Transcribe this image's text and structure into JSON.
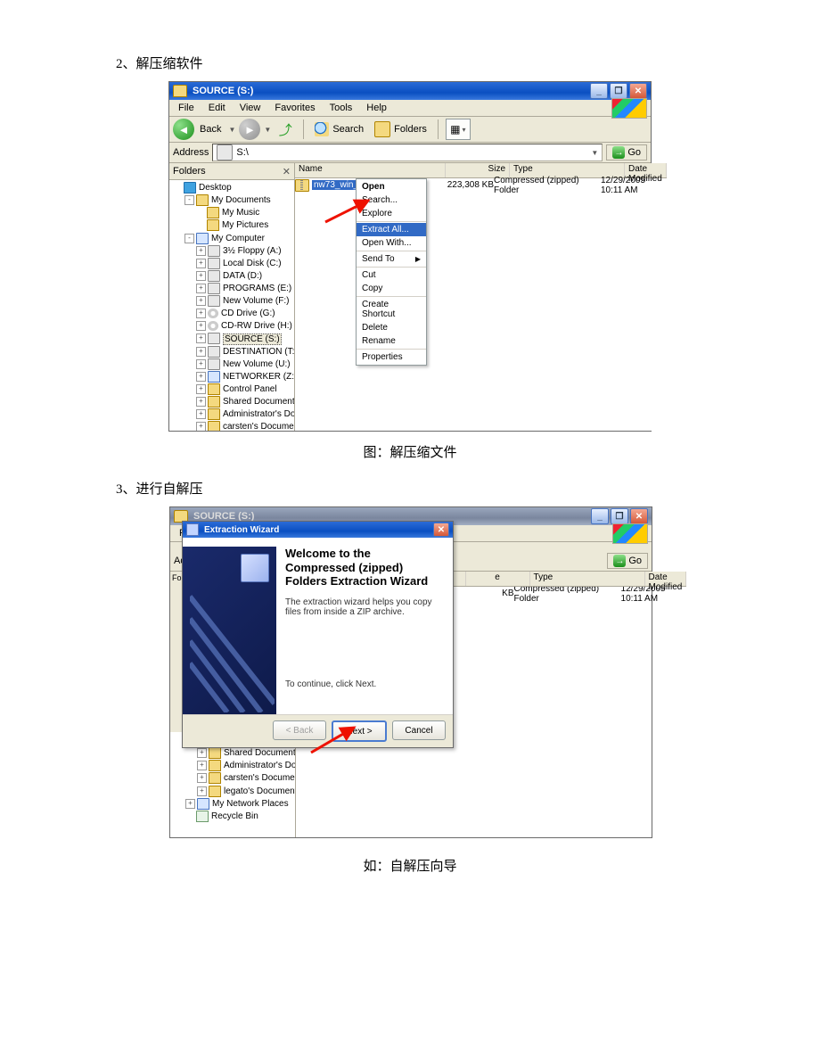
{
  "doc": {
    "step2": "2、解压缩软件",
    "caption1": "图：解压缩文件",
    "step3": "3、进行自解压",
    "caption2": "如：自解压向导"
  },
  "explorer": {
    "title": "SOURCE (S:)",
    "menu": [
      "File",
      "Edit",
      "View",
      "Favorites",
      "Tools",
      "Help"
    ],
    "back": "Back",
    "search": "Search",
    "folders": "Folders",
    "go": "Go",
    "addressLabel": "Address",
    "addressValue": "S:\\",
    "foldersHeader": "Folders",
    "columns": {
      "name": "Name",
      "size": "Size",
      "type": "Type",
      "date": "Date Modified"
    },
    "file": {
      "name": "nw73_win_x86",
      "size": "223,308 KB",
      "type": "Compressed (zipped) Folder",
      "date": "12/29/2005 10:11 AM"
    },
    "tree": {
      "desktop": "Desktop",
      "mydocs": "My Documents",
      "mymusic": "My Music",
      "mypics": "My Pictures",
      "mycomp": "My Computer",
      "drives": [
        "3½ Floppy (A:)",
        "Local Disk (C:)",
        "DATA (D:)",
        "PROGRAMS (E:)",
        "New Volume (F:)",
        "CD Drive (G:)",
        "CD-RW Drive (H:)",
        "SOURCE (S:)",
        "DESTINATION (T:)",
        "New Volume (U:)",
        "NETWORKER (Z:)",
        "Control Panel",
        "Shared Documents",
        "Administrator's Documents",
        "carsten's Documents",
        "legato's Documents"
      ],
      "netplaces": "My Network Places",
      "recycle": "Recycle Bin"
    },
    "treeBottom": [
      "Control Panel",
      "Shared Documents",
      "Administrator's Documents",
      "carsten's Documents",
      "legato's Documents"
    ]
  },
  "ctx": {
    "open": "Open",
    "search": "Search...",
    "explore": "Explore",
    "extract": "Extract All...",
    "openwith": "Open With...",
    "sendto": "Send To",
    "cut": "Cut",
    "copy": "Copy",
    "shortcut": "Create Shortcut",
    "delete": "Delete",
    "rename": "Rename",
    "props": "Properties"
  },
  "wizard": {
    "title": "Extraction Wizard",
    "heading": "Welcome to the Compressed (zipped) Folders Extraction Wizard",
    "text1": "The extraction wizard helps you copy files from inside a ZIP archive.",
    "text2": "To continue, click Next.",
    "back": "< Back",
    "next": "Next >",
    "cancel": "Cancel"
  },
  "behind": {
    "sizeTrunc": "KB",
    "type": "Compressed (zipped) Folder",
    "date": "12/29/2005 10:11 AM"
  }
}
